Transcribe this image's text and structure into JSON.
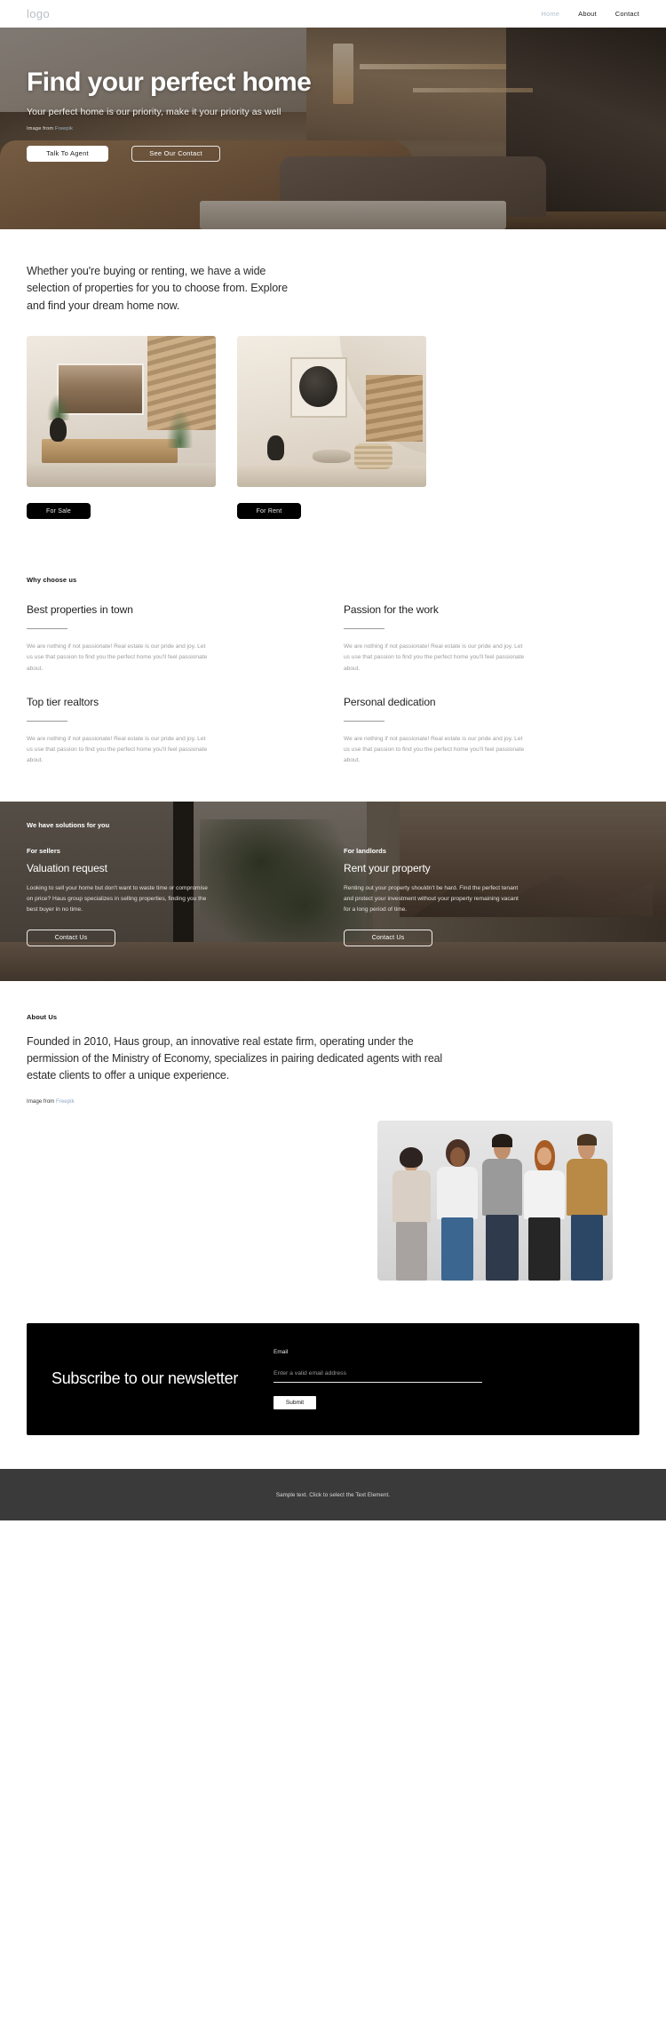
{
  "header": {
    "logo": "logo",
    "nav": [
      {
        "label": "Home",
        "active": true
      },
      {
        "label": "About",
        "active": false
      },
      {
        "label": "Contact",
        "active": false
      }
    ]
  },
  "hero": {
    "title": "Find your perfect home",
    "subtitle": "Your perfect home is our priority, make it your priority as well",
    "credit_prefix": "Image from ",
    "credit_link": "Freepik",
    "primary_button": "Talk To Agent",
    "secondary_button": "See Our Contact"
  },
  "intro": {
    "paragraph": "Whether you're buying or renting, we have a wide selection of properties for you to choose from. Explore and find your dream home now."
  },
  "properties": {
    "cards": [
      {
        "tag": "For Sale",
        "image_name": "living-room-with-artwork"
      },
      {
        "tag": "For Rent",
        "image_name": "living-room-with-spiral-staircase"
      }
    ]
  },
  "why_choose_us": {
    "eyebrow": "Why choose us",
    "items": [
      {
        "title": "Best properties in town",
        "body": "We are nothing if not passionate! Real estate is our pride and joy. Let us use that passion to find you the perfect home you'll feel passionate about."
      },
      {
        "title": "Passion for the work",
        "body": "We are nothing if not passionate! Real estate is our pride and joy. Let us use that passion to find you the perfect home you'll feel passionate about."
      },
      {
        "title": "Top tier realtors",
        "body": "We are nothing if not passionate! Real estate is our pride and joy. Let us use that passion to find you the perfect home you'll feel passionate about."
      },
      {
        "title": "Personal dedication",
        "body": "We are nothing if not passionate! Real estate is our pride and joy. Let us use that passion to find you the perfect home you'll feel passionate about."
      }
    ]
  },
  "solutions": {
    "eyebrow": "We have solutions for you",
    "columns": [
      {
        "label": "For sellers",
        "title": "Valuation request",
        "body": "Looking to sell your home but don't want to waste time or compromise on price? Haus group specializes in selling properties, finding you the best buyer in no time.",
        "button": "Contact Us"
      },
      {
        "label": "For landlords",
        "title": "Rent your property",
        "body": "Renting out your property shouldn't be hard. Find the perfect tenant and protect your investment without your property remaining vacant for a long period of time.",
        "button": "Contact Us"
      }
    ]
  },
  "about": {
    "eyebrow": "About Us",
    "body": "Founded in 2010, Haus group, an innovative real estate firm, operating under the permission of the Ministry of Economy, specializes in pairing dedicated agents with real estate clients to offer a unique experience.",
    "credit_prefix": "Image from ",
    "credit_link": "Freepik",
    "image_name": "team-of-five-agents"
  },
  "newsletter": {
    "title": "Subscribe to our newsletter",
    "email_label": "Email",
    "email_value": "",
    "email_placeholder": "Enter a valid email address",
    "submit_label": "Submit"
  },
  "footer": {
    "text": "Sample text. Click to select the Text Element."
  },
  "colors": {
    "accent_link": "#9fb6c9",
    "nav_active": "#b2c3d3",
    "dark": "#000000",
    "footer_bg": "#3a3a3a"
  }
}
